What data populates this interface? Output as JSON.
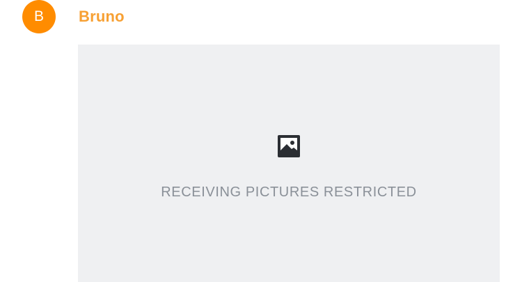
{
  "colors": {
    "avatar_background": "#FF8C00",
    "avatar_letter": "#FFFFFF",
    "sender_name": "#F7A033",
    "media_background": "#EFF0F2",
    "icon": "#2B2E33",
    "restricted_text": "#8A9098"
  },
  "message": {
    "avatar_letter": "B",
    "sender_name": "Bruno",
    "media": {
      "icon": "picture-icon",
      "restricted_label": "RECEIVING PICTURES RESTRICTED"
    }
  }
}
